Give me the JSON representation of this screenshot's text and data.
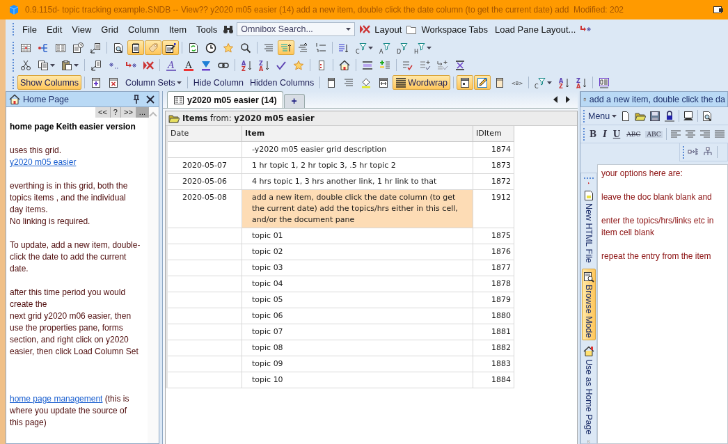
{
  "window": {
    "title": "0.9.115d- topic tracking example.SNDB -- View?? y2020 m05 easier (14) add a new item, double click the date column (to get the current date) add  Modified: 202"
  },
  "menu_bar": {
    "items": [
      "File",
      "Edit",
      "View",
      "Grid",
      "Column",
      "Item",
      "Tools"
    ],
    "omnibox": {
      "placeholder": "Omnibox Search..."
    },
    "commands": [
      "Layout",
      "Workspace Tabs",
      "Load Pane Layout..."
    ]
  },
  "toolbars": [
    {
      "items": [
        {
          "kind": "icon",
          "selected": false,
          "menu": false
        },
        {
          "kind": "icon",
          "selected": false,
          "menu": false
        },
        {
          "kind": "icon",
          "selected": false,
          "menu": false
        },
        {
          "kind": "icon",
          "selected": false,
          "menu": false
        },
        {
          "kind": "icon",
          "selected": false,
          "menu": false
        },
        {
          "kind": "separator"
        },
        {
          "kind": "icon",
          "selected": false,
          "menu": false
        },
        {
          "kind": "icon",
          "selected": true,
          "menu": false
        },
        {
          "kind": "icon",
          "selected": true,
          "menu": false
        },
        {
          "kind": "icon",
          "selected": true,
          "menu": false
        },
        {
          "kind": "separator"
        },
        {
          "kind": "icon",
          "selected": false,
          "menu": false
        },
        {
          "kind": "icon",
          "selected": false,
          "menu": false
        },
        {
          "kind": "icon",
          "selected": false,
          "menu": false
        },
        {
          "kind": "icon",
          "selected": false,
          "menu": false
        },
        {
          "kind": "separator"
        },
        {
          "kind": "icon",
          "selected": false,
          "menu": false
        },
        {
          "kind": "icon",
          "selected": true,
          "menu": false
        },
        {
          "kind": "icon",
          "selected": false,
          "menu": false
        },
        {
          "kind": "icon",
          "selected": false,
          "menu": false
        },
        {
          "kind": "separator"
        },
        {
          "kind": "icon",
          "selected": false,
          "menu": false
        },
        {
          "kind": "icon",
          "label": "C",
          "selected": false,
          "menu": true
        },
        {
          "kind": "icon",
          "label": "A",
          "selected": false,
          "menu": false
        },
        {
          "kind": "icon",
          "label": "D",
          "selected": false,
          "menu": false
        },
        {
          "kind": "icon",
          "label": "H",
          "selected": false,
          "menu": true
        }
      ]
    },
    {
      "items": [
        {
          "kind": "icon",
          "selected": false,
          "menu": false
        },
        {
          "kind": "icon",
          "selected": false,
          "menu": true
        },
        {
          "kind": "icon",
          "selected": false,
          "menu": true
        },
        {
          "kind": "separator"
        },
        {
          "kind": "icon",
          "selected": false,
          "menu": false
        },
        {
          "kind": "icon",
          "selected": false,
          "menu": false
        },
        {
          "kind": "icon",
          "selected": false,
          "menu": false
        },
        {
          "kind": "icon",
          "selected": false,
          "menu": false
        },
        {
          "kind": "separator"
        },
        {
          "kind": "icon",
          "label": "A",
          "selected": false,
          "menu": false
        },
        {
          "kind": "icon",
          "label": "A",
          "selected": false,
          "menu": false
        },
        {
          "kind": "icon",
          "selected": false,
          "menu": false
        },
        {
          "kind": "icon",
          "selected": false,
          "menu": false
        },
        {
          "kind": "separator"
        },
        {
          "kind": "icon",
          "label": "AZ",
          "selected": false,
          "menu": false
        },
        {
          "kind": "icon",
          "label": "ZA",
          "selected": false,
          "menu": false
        },
        {
          "kind": "icon",
          "selected": false,
          "menu": false
        },
        {
          "kind": "icon",
          "selected": false,
          "menu": false
        },
        {
          "kind": "separator"
        },
        {
          "kind": "icon",
          "selected": false,
          "menu": false
        },
        {
          "kind": "separator"
        },
        {
          "kind": "icon",
          "selected": false,
          "menu": false
        },
        {
          "kind": "separator"
        },
        {
          "kind": "icon",
          "selected": false,
          "menu": false
        },
        {
          "kind": "icon",
          "selected": false,
          "menu": false
        },
        {
          "kind": "separator"
        },
        {
          "kind": "icon",
          "selected": false,
          "menu": false
        },
        {
          "kind": "icon",
          "selected": false,
          "menu": false
        },
        {
          "kind": "icon",
          "selected": false,
          "menu": false
        },
        {
          "kind": "icon",
          "selected": false,
          "menu": false
        }
      ]
    },
    {
      "items": [
        {
          "kind": "button",
          "label": "Show Columns",
          "selected": true,
          "menu": false
        },
        {
          "kind": "separator"
        },
        {
          "kind": "icon",
          "selected": false,
          "menu": false
        },
        {
          "kind": "icon",
          "selected": false,
          "menu": false
        },
        {
          "kind": "button",
          "label": "Column Sets",
          "selected": false,
          "menu": true
        },
        {
          "kind": "separator"
        },
        {
          "kind": "button",
          "label": "Hide Column",
          "selected": false,
          "menu": false
        },
        {
          "kind": "button",
          "label": "Hidden Columns",
          "selected": false,
          "menu": false
        },
        {
          "kind": "separator"
        },
        {
          "kind": "icon",
          "selected": false,
          "menu": false
        },
        {
          "kind": "icon",
          "selected": false,
          "menu": false
        },
        {
          "kind": "icon",
          "selected": false,
          "menu": false
        },
        {
          "kind": "icon",
          "selected": false,
          "menu": false
        },
        {
          "kind": "button",
          "label": "Wordwrap",
          "selected": true,
          "menu": false
        },
        {
          "kind": "separator"
        },
        {
          "kind": "icon",
          "selected": true,
          "menu": false
        },
        {
          "kind": "icon",
          "selected": true,
          "menu": false
        },
        {
          "kind": "icon",
          "selected": false,
          "menu": false
        },
        {
          "kind": "icon",
          "label": "<B>",
          "selected": false,
          "menu": false
        },
        {
          "kind": "separator"
        },
        {
          "kind": "icon",
          "label": "C",
          "selected": false,
          "menu": true
        },
        {
          "kind": "icon",
          "label": "AZ",
          "selected": false,
          "menu": false
        },
        {
          "kind": "icon",
          "label": "ZA",
          "selected": false,
          "menu": false
        },
        {
          "kind": "separator"
        },
        {
          "kind": "icon",
          "selected": false,
          "menu": false
        }
      ]
    }
  ],
  "home_pane": {
    "title": "Home Page",
    "nav_buttons": [
      "<<",
      "?",
      ">>",
      "..."
    ],
    "heading": "home page Keith easier version",
    "paragraphs": [
      {
        "runs": [
          {
            "kind": "text",
            "text": "uses this grid."
          },
          {
            "kind": "break"
          },
          {
            "kind": "link",
            "text": "y2020 m05 easier"
          }
        ]
      },
      {
        "runs": [
          {
            "kind": "text",
            "text": "everthing is in this grid, both the topics items , and the individual day items."
          },
          {
            "kind": "break"
          },
          {
            "kind": "text",
            "text": "No linking is required."
          }
        ]
      },
      {
        "runs": [
          {
            "kind": "text",
            "text": "To update, add a new item, double-click the date to add the current date."
          }
        ]
      },
      {
        "runs": [
          {
            "kind": "text",
            "text": "after this time period you would create the"
          },
          {
            "kind": "break"
          },
          {
            "kind": "text",
            "text": "next grid y2020 m06 easier, then use the properties pane, forms section, and right click on y2020 easier, then click Load Column Set"
          }
        ]
      },
      {
        "runs": [
          {
            "kind": "link",
            "text": "home page management"
          },
          {
            "kind": "text",
            "text": "  (this is where you update the source of this page)"
          }
        ]
      }
    ]
  },
  "grid_pane": {
    "tabs": [
      {
        "label": "y2020 m05 easier (14)",
        "selected": true
      }
    ],
    "new_tab": "+",
    "header": "**Items** from: **y2020 m05 easier**",
    "columns": [
      {
        "label": "Date",
        "key": false
      },
      {
        "label": "Item",
        "key": true
      },
      {
        "label": "IDItem",
        "key": false
      }
    ],
    "rows": [
      {
        "item": "-y2020 m05 easier grid description",
        "id": "1874",
        "selected": false
      },
      {
        "date": "2020-05-07",
        "item": "1 hr topic 1, 2 hr topic 3, .5 hr topic 2",
        "id": "1873",
        "selected": false
      },
      {
        "date": "2020-05-06",
        "item": "4 hrs topic 1, 3 hrs another link, 1 hr link to that",
        "id": "1872",
        "selected": false
      },
      {
        "date": "2020-05-08",
        "item": "add a new item, double click the date column (to get the current date) add the topics/hrs either in this cell, and/or the document pane",
        "id": "1912",
        "selected": true
      },
      {
        "item": "topic 01",
        "id": "1875",
        "selected": false
      },
      {
        "item": "topic 02",
        "id": "1876",
        "selected": false
      },
      {
        "item": "topic 03",
        "id": "1877",
        "selected": false
      },
      {
        "item": "topic 04",
        "id": "1878",
        "selected": false
      },
      {
        "item": "topic 05",
        "id": "1879",
        "selected": false
      },
      {
        "item": "topic 06",
        "id": "1880",
        "selected": false
      },
      {
        "item": "topic 07",
        "id": "1881",
        "selected": false
      },
      {
        "item": "topic 08",
        "id": "1882",
        "selected": false
      },
      {
        "item": "topic 09",
        "id": "1883",
        "selected": false
      },
      {
        "item": "topic 10",
        "id": "1884",
        "selected": false
      }
    ]
  },
  "doc_pane": {
    "title": "add a new item, double click the da",
    "menu_label": "Menu",
    "format_buttons": [
      "B",
      "I",
      "U",
      "ABC",
      "ABC"
    ],
    "side_tabs": [
      {
        "label": "New HTML File",
        "selected": false
      },
      {
        "label": "Browse Mode",
        "selected": true
      },
      {
        "label": "Use as Home Page",
        "selected": false
      }
    ],
    "paragraphs": [
      {
        "lines": [
          "your options here are:"
        ]
      },
      {
        "lines": [
          "leave the doc blank blank and"
        ]
      },
      {
        "lines": [
          "enter the topics/hrs/links etc in",
          "item cell blank"
        ]
      },
      {
        "lines": [
          "repeat the entry from the item"
        ]
      }
    ]
  }
}
